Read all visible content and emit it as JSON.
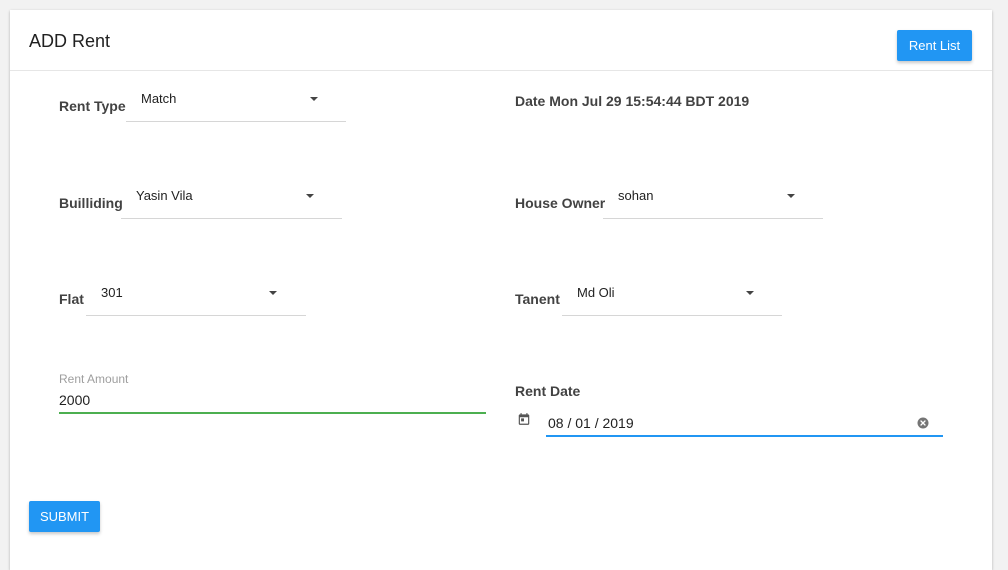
{
  "header": {
    "title": "ADD Rent",
    "rent_list_label": "Rent List"
  },
  "current_date": "Date Mon Jul 29 15:54:44 BDT 2019",
  "fields": {
    "rent_type": {
      "label": "Rent Type",
      "value": "Match"
    },
    "building": {
      "label": "Builliding",
      "value": "Yasin Vila"
    },
    "house_owner": {
      "label": "House Owner",
      "value": "sohan"
    },
    "flat": {
      "label": "Flat",
      "value": "301"
    },
    "tenant": {
      "label": "Tanent",
      "value": "Md Oli"
    },
    "rent_amount": {
      "label": "Rent Amount",
      "value": "2000"
    },
    "rent_date": {
      "label": "Rent Date",
      "value": "08 / 01 / 2019"
    }
  },
  "actions": {
    "submit_label": "SUBMIT"
  },
  "colors": {
    "primary": "#2196f3",
    "focus_green": "#4caf50"
  },
  "icons": [
    "calendar-icon",
    "clear-icon",
    "chevron-down-icon"
  ]
}
